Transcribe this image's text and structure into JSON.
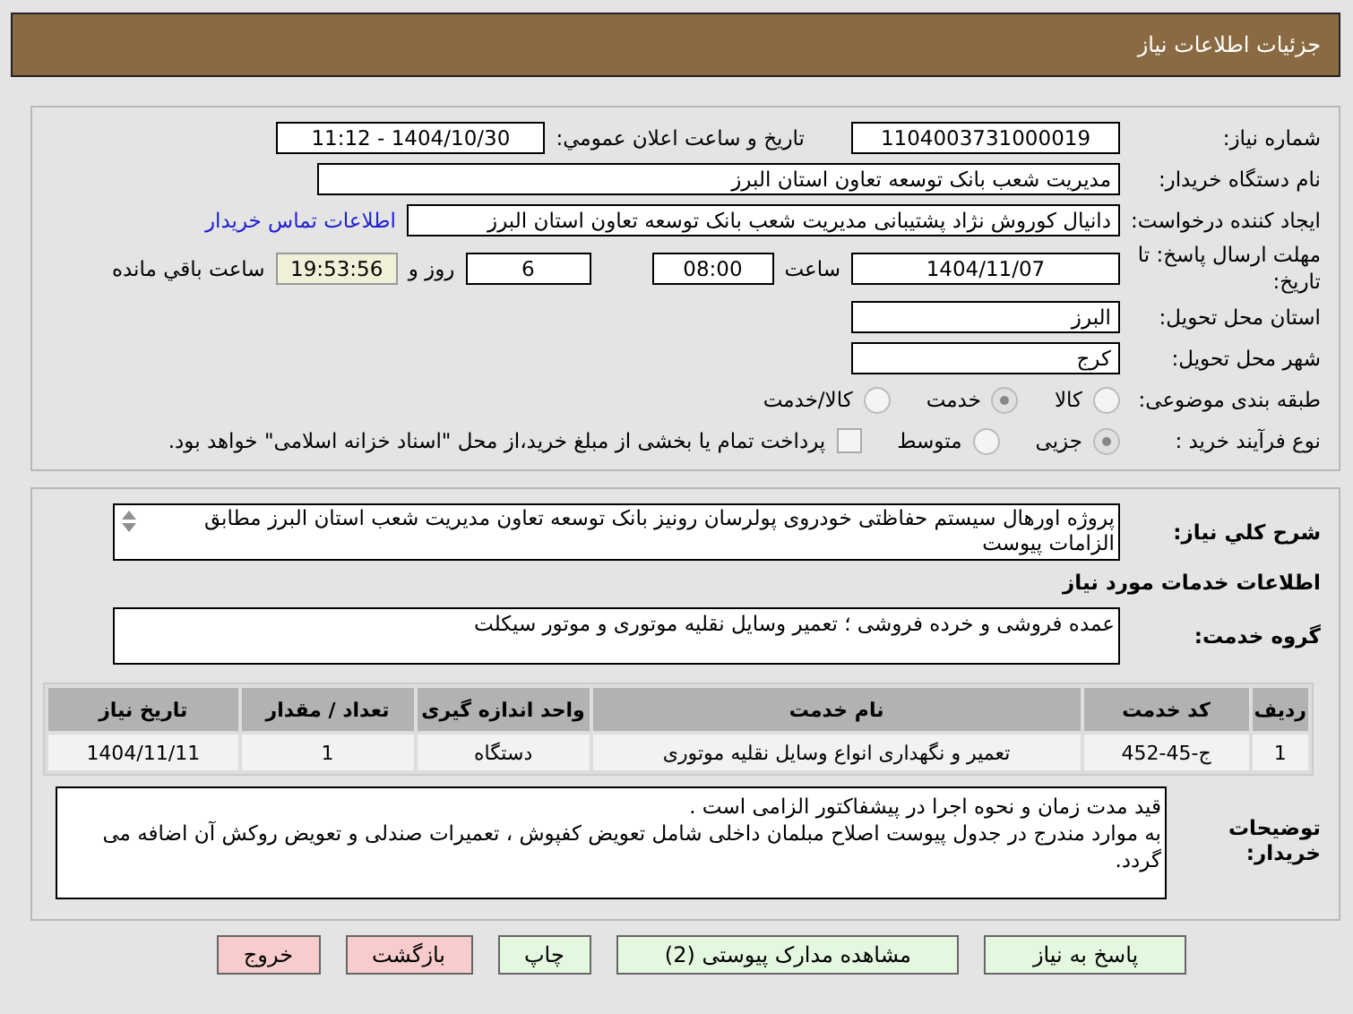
{
  "header": {
    "title": "جزئیات اطلاعات نیاز"
  },
  "need_number": {
    "label": "شماره نیاز:",
    "value": "1104003731000019"
  },
  "announce": {
    "label": "تاریخ و ساعت اعلان عمومي:",
    "value": "1404/10/30 - 11:12"
  },
  "buyer_org": {
    "label": "نام دستگاه خریدار:",
    "value": "مدیریت شعب بانک توسعه تعاون استان البرز"
  },
  "creator": {
    "label": "ایجاد کننده درخواست:",
    "value": "دانیال کوروش نژاد پشتیبانی مدیریت شعب بانک توسعه تعاون استان البرز",
    "link": "اطلاعات تماس خریدار"
  },
  "deadline": {
    "label": "مهلت ارسال پاسخ: تا تاریخ:",
    "date": "1404/11/07",
    "time_label": "ساعت",
    "time": "08:00",
    "days": "6",
    "days_label": "روز و",
    "remaining": "19:53:56",
    "remaining_label": "ساعت باقي مانده"
  },
  "province": {
    "label": "استان محل تحویل:",
    "value": "البرز"
  },
  "city": {
    "label": "شهر محل تحویل:",
    "value": "کرج"
  },
  "category": {
    "label": "طبقه بندی موضوعی:",
    "options": [
      {
        "label": "کالا",
        "selected": false
      },
      {
        "label": "خدمت",
        "selected": true
      },
      {
        "label": "کالا/خدمت",
        "selected": false
      }
    ]
  },
  "process": {
    "label": "نوع فرآیند خرید :",
    "options": [
      {
        "label": "جزیی",
        "selected": true
      },
      {
        "label": "متوسط",
        "selected": false
      }
    ],
    "payment": {
      "checked": false,
      "text": "پرداخت تمام یا بخشی از مبلغ خرید،از محل \"اسناد خزانه اسلامی\" خواهد بود."
    }
  },
  "summary": {
    "label": "شرح کلي نیاز:",
    "value": "پروژه اورهال سیستم حفاظتی خودروی پولرسان رونیز بانک توسعه تعاون مدیریت شعب استان البرز مطابق الزامات پیوست"
  },
  "services_heading": "اطلاعات خدمات مورد نیاز",
  "service_group": {
    "label": "گروه خدمت:",
    "value": "عمده فروشی و خرده فروشی ؛ تعمیر وسایل نقلیه موتوری و موتور سیکلت"
  },
  "table": {
    "columns": [
      "ردیف",
      "کد خدمت",
      "نام خدمت",
      "واحد اندازه گیری",
      "تعداد / مقدار",
      "تاریخ نیاز"
    ],
    "rows": [
      [
        "1",
        "ج-45-452",
        "تعمیر و نگهداری انواع وسایل نقلیه موتوری",
        "دستگاه",
        "1",
        "1404/11/11"
      ]
    ]
  },
  "notes": {
    "label": "توضیحات خریدار:",
    "lines": [
      "قید مدت زمان و نحوه اجرا در پیشفاکتور الزامی است .",
      "به موارد مندرج در جدول پیوست اصلاح مبلمان داخلی شامل تعویض کفپوش ، تعمیرات صندلی و تعویض روکش آن اضافه می گردد."
    ]
  },
  "buttons": [
    {
      "label": "پاسخ به نیاز",
      "kind": "normal"
    },
    {
      "label": "مشاهده مدارک پیوستی (2)",
      "kind": "normal"
    },
    {
      "label": "چاپ",
      "kind": "normal"
    },
    {
      "label": "بازگشت",
      "kind": "exit"
    },
    {
      "label": "خروج",
      "kind": "exit"
    }
  ]
}
